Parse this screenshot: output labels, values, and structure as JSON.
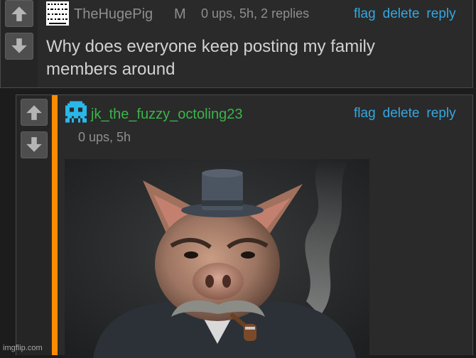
{
  "comments": [
    {
      "username": "TheHugePig",
      "badge": "M",
      "meta": "0 ups, 5h, 2 replies",
      "actions": [
        "flag",
        "delete",
        "reply"
      ],
      "text_lines": [
        "Why does everyone keep posting my family",
        "members around"
      ],
      "username_color": "#8e8e8e"
    },
    {
      "username": "jk_the_fuzzy_octoling23",
      "meta": "0 ups, 5h",
      "actions": [
        "flag",
        "delete",
        "reply"
      ],
      "username_color": "#39b54a",
      "accent_color": "#ff8c00",
      "image_alt": "pig wearing top hat with mustache and pipe"
    }
  ],
  "watermark": "imgflip.com"
}
